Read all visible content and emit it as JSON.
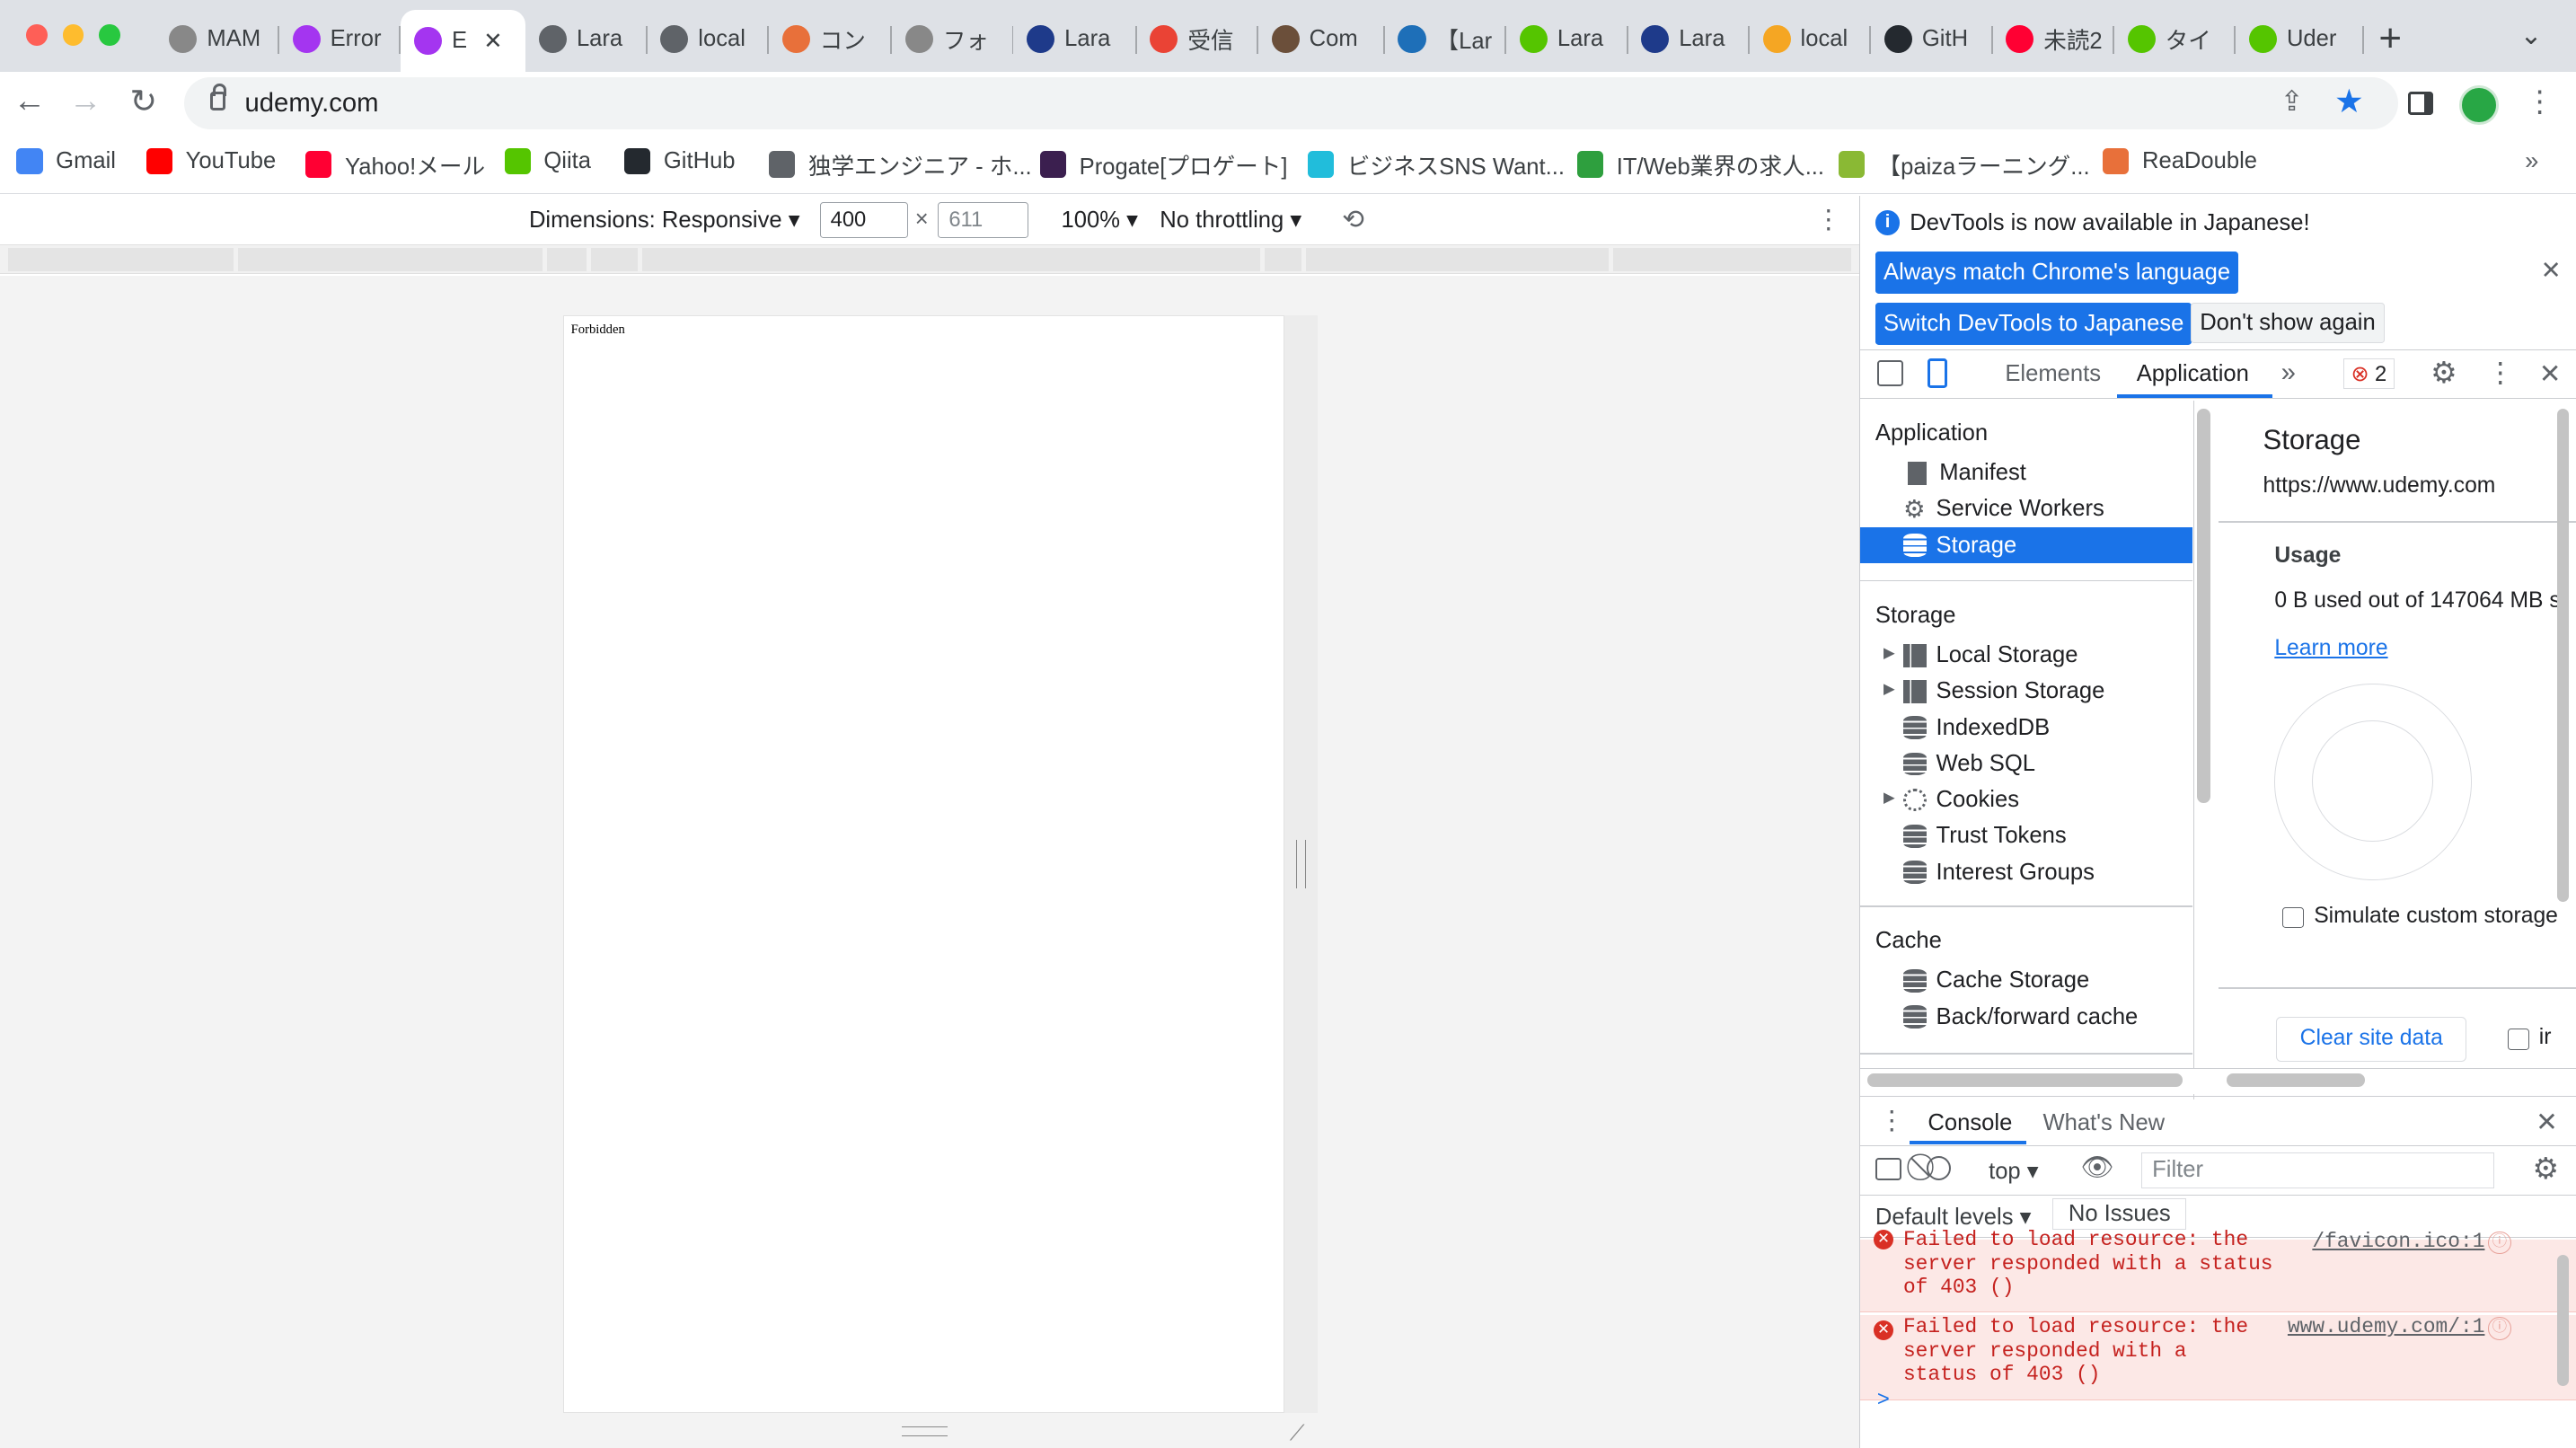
{
  "tabs": [
    {
      "label": "MAM",
      "icon": "github-icon",
      "color": "#888"
    },
    {
      "label": "Error",
      "icon": "udemy-icon",
      "color": "#a435f0"
    },
    {
      "label": "E",
      "icon": "udemy-icon",
      "color": "#a435f0",
      "active": true
    },
    {
      "label": "Lara",
      "icon": "globe-icon",
      "color": "#5f6368"
    },
    {
      "label": "local",
      "icon": "globe-icon",
      "color": "#5f6368"
    },
    {
      "label": "コン",
      "icon": "readouble-icon",
      "color": "#e8703a"
    },
    {
      "label": "フォ",
      "icon": "github-icon",
      "color": "#888"
    },
    {
      "label": "Lara",
      "icon": "laravel-icon",
      "color": "#1e3a8a"
    },
    {
      "label": "受信",
      "icon": "gmail-icon",
      "color": "#ea4335"
    },
    {
      "label": "Com",
      "icon": "composer-icon",
      "color": "#6b4f3a"
    },
    {
      "label": "【Lar",
      "icon": "cg-icon",
      "color": "#1e6fb8"
    },
    {
      "label": "Lara",
      "icon": "qiita-icon",
      "color": "#55c500"
    },
    {
      "label": "Lara",
      "icon": "laravel-icon",
      "color": "#1e3a8a"
    },
    {
      "label": "local",
      "icon": "pma-icon",
      "color": "#f5a623"
    },
    {
      "label": "GitH",
      "icon": "github-icon",
      "color": "#24292f"
    },
    {
      "label": "未読2",
      "icon": "yahoo-icon",
      "color": "#ff0033"
    },
    {
      "label": "タイ",
      "icon": "qiita-icon",
      "color": "#55c500"
    },
    {
      "label": "Uder",
      "icon": "qiita-icon",
      "color": "#55c500"
    }
  ],
  "address": {
    "url": "udemy.com"
  },
  "bookmarks": [
    {
      "label": "Gmail",
      "icon": "google-icon",
      "color": "#4285f4"
    },
    {
      "label": "YouTube",
      "icon": "youtube-icon",
      "color": "#ff0000"
    },
    {
      "label": "Yahoo!メール",
      "icon": "yahoo-icon",
      "color": "#ff0033"
    },
    {
      "label": "Qiita",
      "icon": "qiita-icon",
      "color": "#55c500"
    },
    {
      "label": "GitHub",
      "icon": "github-icon",
      "color": "#24292f"
    },
    {
      "label": "独学エンジニア - ホ...",
      "icon": "globe-icon",
      "color": "#5f6368"
    },
    {
      "label": "Progate[プロゲート]",
      "icon": "progate-icon",
      "color": "#3b1f4f"
    },
    {
      "label": "ビジネスSNS Want...",
      "icon": "wantedly-icon",
      "color": "#21bddb"
    },
    {
      "label": "IT/Web業界の求人...",
      "icon": "green-icon",
      "color": "#2e9f3e"
    },
    {
      "label": "【paizaラーニング...",
      "icon": "paiza-icon",
      "color": "#8ab934"
    },
    {
      "label": "ReaDouble",
      "icon": "readouble-icon",
      "color": "#e8703a"
    }
  ],
  "device_toolbar": {
    "dimensions": "Dimensions: Responsive",
    "width": "400",
    "height": "611",
    "times": "×",
    "zoom": "100%",
    "throttling": "No throttling"
  },
  "page": {
    "text": "Forbidden"
  },
  "devtools": {
    "info": "DevTools is now available in Japanese!",
    "btn_match": "Always match Chrome's language",
    "btn_switch": "Switch DevTools to Japanese",
    "btn_dont": "Don't show again",
    "tab_elements": "Elements",
    "tab_application": "Application",
    "error_count": "2",
    "sections": {
      "application": "Application",
      "storage": "Storage",
      "cache": "Cache"
    },
    "app_items": [
      "Manifest",
      "Service Workers",
      "Storage"
    ],
    "storage_items": [
      "Local Storage",
      "Session Storage",
      "IndexedDB",
      "Web SQL",
      "Cookies",
      "Trust Tokens",
      "Interest Groups"
    ],
    "cache_items": [
      "Cache Storage",
      "Back/forward cache"
    ],
    "right": {
      "title": "Storage",
      "origin": "https://www.udemy.com",
      "usage_title": "Usage",
      "usage_text": "0 B used out of 147064 MB s",
      "learn_more": "Learn more",
      "simulate": "Simulate custom storage",
      "clear": "Clear site data",
      "check_label": "ir"
    },
    "drawer": {
      "tab_console": "Console",
      "tab_whats_new": "What's New",
      "context": "top",
      "filter_placeholder": "Filter",
      "levels": "Default levels",
      "issues": "No Issues",
      "errors": [
        {
          "lines": [
            "Failed to load resource: the",
            "server responded with a status",
            "of 403 ()"
          ],
          "link": "/favicon.ico:1"
        },
        {
          "lines": [
            "Failed to load resource: the",
            "server responded with a",
            "status of 403 ()"
          ],
          "link": "www.udemy.com/:1"
        }
      ],
      "prompt": ">"
    }
  },
  "colors": {
    "accent": "#1a73e8",
    "error_bg": "#fce8e6",
    "error_text": "#c5221f"
  }
}
